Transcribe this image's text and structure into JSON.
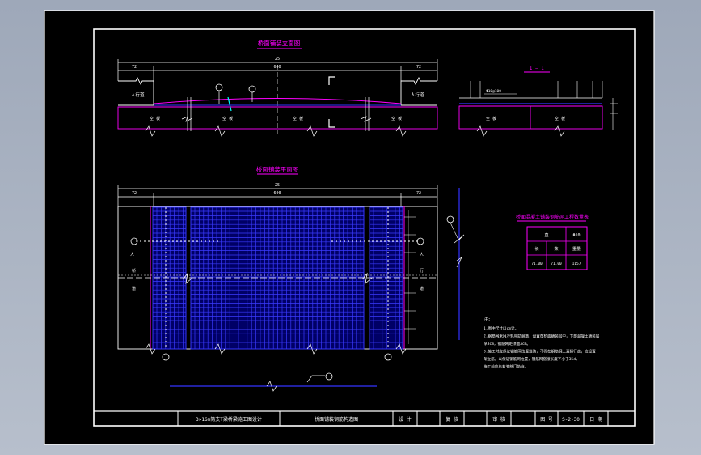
{
  "drawing": {
    "titles": {
      "section_a": "桥面铺装立面图",
      "section_b": "I — I",
      "plan": "桥面铺装平面图",
      "table": "桥面混凝土铺装钢筋网工程数量表"
    },
    "dims": {
      "total": "25",
      "middle": "600",
      "side_left": "72",
      "side_right": "72",
      "rebar_b": "Φ10@100"
    },
    "labels": {
      "sidewalk_left": "人行道",
      "sidewalk_right": "人行道",
      "slab": "空 板",
      "plan_mark_1": "人",
      "plan_mark_2": "桥",
      "plan_mark_3": "道",
      "plan_mark_4": "人",
      "plan_mark_5": "行",
      "plan_mark_6": "道"
    },
    "table": {
      "header": [
        "直",
        "Φ10"
      ],
      "row1": [
        "长",
        "数",
        "重量"
      ],
      "row2": [
        "71.00",
        "71.00",
        "1157"
      ]
    },
    "notes": {
      "title": "注:",
      "lines": [
        "1.图中尺寸以cm计。",
        "2.钢筋网采用冷轧带肋钢筋，设置在桥面铺装层中，下部混凝土铺装层",
        "  厚8cm，钢筋网距顶面3cm。",
        "3.施工时应保证钢筋网位置准确，不得在钢筋网上直接行走，应设置",
        "  架立筋，以保证钢筋网位置，钢筋网搭接长度不小于35d，",
        "  施工前应与有关部门协商。"
      ]
    }
  },
  "title_block": {
    "project": "3×16m简支T梁桥梁施工图设计",
    "drawing_name": "桥面铺装钢筋构造图",
    "design_label": "设 计",
    "check_label": "复 核",
    "review_label": "审 核",
    "sheet_label": "图 号",
    "sheet_no": "S-2-30",
    "date_label": "日 期"
  },
  "colors": {
    "sheet": "#000000",
    "frame": "#ffffff",
    "title": "#ff00ff",
    "mesh": "#3333ff",
    "dims": "#ffffff",
    "accent": "#00ffff"
  }
}
